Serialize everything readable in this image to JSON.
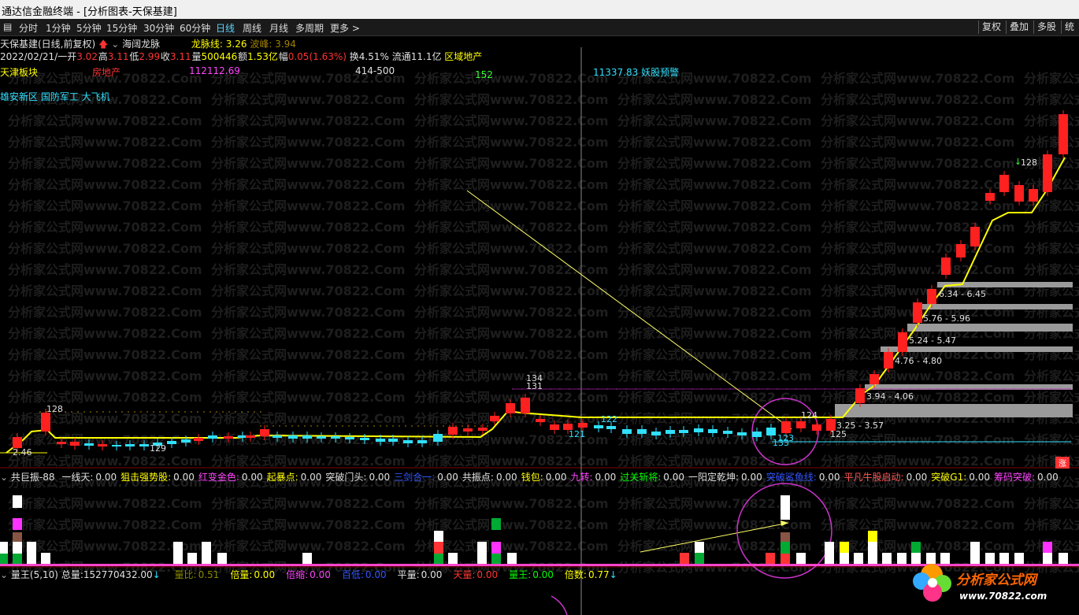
{
  "window": {
    "title": "通达信金融终端 - [分析图表-天保基建]"
  },
  "toolbar": {
    "periods": [
      "分时",
      "1分钟",
      "5分钟",
      "15分钟",
      "30分钟",
      "60分钟",
      "日线",
      "周线",
      "月线",
      "多周期",
      "更多 >"
    ],
    "active": "日线",
    "right_buttons": [
      "复权",
      "叠加",
      "多股",
      "统"
    ]
  },
  "stock": {
    "name": "天保基建(日线,前复权)",
    "indicator_name": "海阔龙脉",
    "dragon_line_label": "龙脉线: 3.26",
    "peak_label": "波峰: 3.94"
  },
  "quote": {
    "date": "2022/02/21/一",
    "open_label": "开",
    "open": "3.02",
    "high_label": "高",
    "high": "3.11",
    "low_label": "低",
    "low": "2.99",
    "close_label": "收",
    "close": "3.11",
    "vol_label": "量",
    "vol": "500446",
    "amount_label": "额",
    "amount": "1.53亿",
    "change_label": "幅",
    "change": "0.05(1.63%)",
    "turnover_label": "换",
    "turnover": "4.51%",
    "float_label": "流通",
    "float": "11.1亿",
    "sector": "区域地产"
  },
  "tags": {
    "region": "天津板块",
    "industry": "房地产",
    "num1": "112112.69",
    "range": "414-500",
    "num2": "152",
    "warning": "11337.83 妖股预警",
    "concepts": "雄安新区 国防军工 大飞机"
  },
  "price_annotations": {
    "low_start": "2.46",
    "peak1": "128",
    "dip1": "129",
    "peak2a": "134",
    "peak2b": "131",
    "dip2": "121",
    "mid": "122",
    "p124": "124",
    "p123": "123",
    "p133": "133",
    "p125": "125",
    "top": "128",
    "zones": [
      "6.34 - 6.45",
      "5.76 - 5.96",
      "5.24 - 5.47",
      "4.76 - 4.80",
      "3.94 - 4.06",
      "3.25 - 3.57"
    ],
    "limit_tag": "涨"
  },
  "panel2": {
    "title": "共巨振-88",
    "items": [
      {
        "label": "一线天:",
        "value": "0.00",
        "color": "#e0e0e0"
      },
      {
        "label": "狙击强势股:",
        "value": "0.00",
        "color": "#ffff00"
      },
      {
        "label": "红变金色:",
        "value": "0.00",
        "color": "#ff44ff"
      },
      {
        "label": "起暴点:",
        "value": "0.00",
        "color": "#ffff00"
      },
      {
        "label": "突破门头:",
        "value": "0.00",
        "color": "#e0e0e0"
      },
      {
        "label": "三剑合一:",
        "value": "0.00",
        "color": "#3355ff"
      },
      {
        "label": "共振点:",
        "value": "0.00",
        "color": "#e0e0e0"
      },
      {
        "label": "钱包:",
        "value": "0.00",
        "color": "#ffff00"
      },
      {
        "label": "九转:",
        "value": "0.00",
        "color": "#ff44ff"
      },
      {
        "label": "过关斩将:",
        "value": "0.00",
        "color": "#00ff00"
      },
      {
        "label": "一阳定乾坤:",
        "value": "0.00",
        "color": "#e0e0e0"
      },
      {
        "label": "突破鲨鱼线:",
        "value": "0.00",
        "color": "#3355ff"
      },
      {
        "label": "平凡牛股启动:",
        "value": "0.00",
        "color": "#ff5555"
      },
      {
        "label": "突破G1:",
        "value": "0.00",
        "color": "#ffff00"
      },
      {
        "label": "筹码突破:",
        "value": "0.00",
        "color": "#ff44ff"
      }
    ]
  },
  "panel3": {
    "title": "量王(5,10)",
    "total_label": "总量:",
    "total": "152770432.00",
    "items": [
      {
        "label": "量比:",
        "value": "0.51",
        "color": "#888800"
      },
      {
        "label": "倍量:",
        "value": "0.00",
        "color": "#ffff00"
      },
      {
        "label": "倍缩:",
        "value": "0.00",
        "color": "#ff44ff"
      },
      {
        "label": "百低:",
        "value": "0.00",
        "color": "#3355ff"
      },
      {
        "label": "平量:",
        "value": "0.00",
        "color": "#e0e0e0"
      },
      {
        "label": "天量:",
        "value": "0.00",
        "color": "#ff3333"
      },
      {
        "label": "量王:",
        "value": "0.00",
        "color": "#00ff00"
      },
      {
        "label": "倍数:",
        "value": "0.77",
        "color": "#ffff00"
      }
    ]
  },
  "watermark": {
    "text": "分析家公式网www.70822.Com",
    "logo": "分析家公式网",
    "url": "www.70822.com"
  },
  "colors": {
    "up": "#ff2020",
    "down": "#30e0ff",
    "yellow": "#ffff00",
    "purple": "#cc33cc",
    "gray": "#9a9a9a"
  }
}
